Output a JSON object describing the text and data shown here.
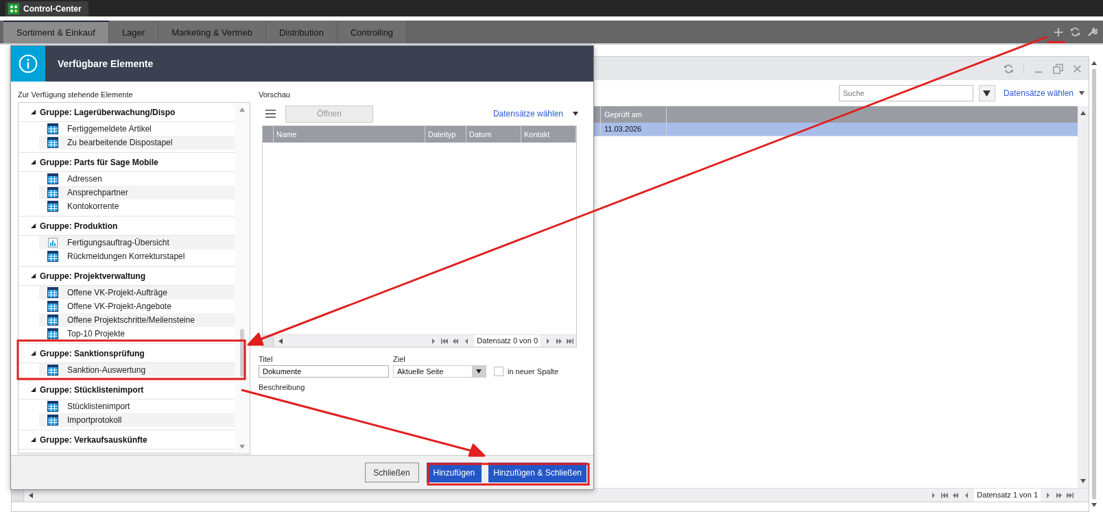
{
  "app_tab": {
    "title": "Control-Center"
  },
  "tabs": [
    {
      "label": "Sortiment & Einkauf",
      "selected": true
    },
    {
      "label": "Lager",
      "selected": false
    },
    {
      "label": "Marketing & Vertrieb",
      "selected": false
    },
    {
      "label": "Distribution",
      "selected": false
    },
    {
      "label": "Controlling",
      "selected": false
    }
  ],
  "widget": {
    "search": {
      "placeholder": "Suche"
    },
    "records_link": "Datensätze wählen",
    "columns": [
      "Geprüft am"
    ],
    "rows": [
      {
        "cells": [
          "11.03.2026"
        ],
        "selected": true
      }
    ],
    "pager": "Datensatz 1 von 1"
  },
  "dialog": {
    "title": "Verfügbare Elemente",
    "list_label": "Zur Verfügung stehende Elemente",
    "groups": [
      {
        "title": "Gruppe: Lagerüberwachung/Dispo",
        "expanded": true,
        "items": [
          {
            "label": "Fertiggemeldete Artikel",
            "kind": "table"
          },
          {
            "label": "Zu bearbeitende Dispostapel",
            "kind": "table"
          }
        ]
      },
      {
        "title": "Gruppe: Parts für Sage Mobile",
        "expanded": true,
        "items": [
          {
            "label": "Adressen",
            "kind": "table"
          },
          {
            "label": "Ansprechpartner",
            "kind": "table"
          },
          {
            "label": "Kontokorrente",
            "kind": "table"
          }
        ]
      },
      {
        "title": "Gruppe: Produktion",
        "expanded": true,
        "items": [
          {
            "label": "Fertigungsauftrag-Übersicht",
            "kind": "chart"
          },
          {
            "label": "Rückmeldungen Korrekturstapel",
            "kind": "table"
          }
        ]
      },
      {
        "title": "Gruppe: Projektverwaltung",
        "expanded": true,
        "items": [
          {
            "label": "Offene VK-Projekt-Aufträge",
            "kind": "table"
          },
          {
            "label": "Offene VK-Projekt-Angebote",
            "kind": "table"
          },
          {
            "label": "Offene Projektschritte/Meilensteine",
            "kind": "table"
          },
          {
            "label": "Top-10 Projekte",
            "kind": "table"
          }
        ]
      },
      {
        "title": "Gruppe: Sanktionsprüfung",
        "expanded": true,
        "items": [
          {
            "label": "Sanktion-Auswertung",
            "kind": "table"
          }
        ]
      },
      {
        "title": "Gruppe: Stücklistenimport",
        "expanded": true,
        "items": [
          {
            "label": "Stücklistenimport",
            "kind": "table"
          },
          {
            "label": "Importprotokoll",
            "kind": "table"
          }
        ]
      },
      {
        "title": "Gruppe: Verkaufsauskünfte",
        "expanded": true
      }
    ],
    "preview": {
      "label": "Vorschau",
      "open_button": {
        "label": "Öffnen",
        "disabled": true
      },
      "records_link": "Datensätze wählen",
      "columns": [
        "Name",
        "Dateityp",
        "Datum",
        "Kontakt"
      ],
      "pager": "Datensatz 0 von 0"
    },
    "form": {
      "title_label": "Titel",
      "title_value": "Dokumente",
      "target_label": "Ziel",
      "target_value": "Aktuelle Seite",
      "new_column": {
        "label": "in neuer Spalte",
        "checked": false
      },
      "description_label": "Beschreibung"
    },
    "buttons": [
      {
        "label": "Schließen",
        "kind": "secondary"
      },
      {
        "label": "Hinzufügen",
        "kind": "primary"
      },
      {
        "label": "Hinzufügen & Schließen",
        "kind": "primary"
      }
    ]
  }
}
